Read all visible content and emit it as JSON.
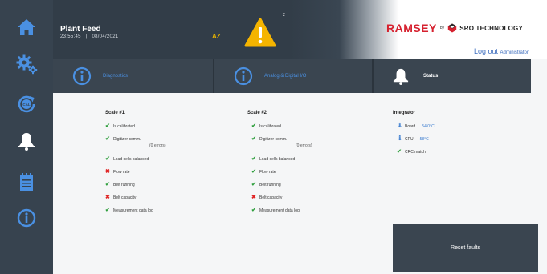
{
  "header": {
    "plant_name": "Plant Feed",
    "time": "23:55:45",
    "separator": "|",
    "date": "08/04/2021",
    "user_initials": "AZ",
    "alarm_count": "2",
    "logo_ramsey": "RAMSEY",
    "logo_by": "by",
    "logo_sro": "SRO TECHNOLOGY",
    "logout_label": "Log out",
    "logout_role": "Administrator"
  },
  "tabs": [
    {
      "label": "Diagnostics",
      "icon": "info-icon"
    },
    {
      "label": "Analog & Digital I/O",
      "icon": "info-icon"
    },
    {
      "label": "Status",
      "icon": "bell-icon"
    }
  ],
  "scale1": {
    "title": "Scale #1",
    "items": [
      {
        "label": "Is calibrated",
        "status": "ok"
      },
      {
        "label": "Digitizer comm.",
        "status": "ok",
        "sub": "(0 errors)"
      },
      {
        "label": "Load cells balanced",
        "status": "ok"
      },
      {
        "label": "Flow rate",
        "status": "bad"
      },
      {
        "label": "Belt running",
        "status": "ok"
      },
      {
        "label": "Belt capacity",
        "status": "bad"
      },
      {
        "label": "Measurement data log",
        "status": "ok"
      }
    ]
  },
  "scale2": {
    "title": "Scale #2",
    "items": [
      {
        "label": "Is calibrated",
        "status": "ok"
      },
      {
        "label": "Digitizer comm.",
        "status": "ok",
        "sub": "(0 errors)"
      },
      {
        "label": "Load cells balanced",
        "status": "ok"
      },
      {
        "label": "Flow rate",
        "status": "ok"
      },
      {
        "label": "Belt running",
        "status": "ok"
      },
      {
        "label": "Belt capacity",
        "status": "bad"
      },
      {
        "label": "Measurement data log",
        "status": "ok"
      }
    ]
  },
  "integrator": {
    "title": "Integrator",
    "board_label": "Board",
    "board_value": "54.0°C",
    "cpu_label": "CPU",
    "cpu_value": "58°C",
    "crc_label": "CRC match"
  },
  "reset_label": "Reset faults",
  "colors": {
    "sidebar": "#37434f",
    "accent_blue": "#4a90e2",
    "ok_green": "#2e9e3c",
    "fault_red": "#e02424",
    "warning_yellow": "#f5b400",
    "brand_red": "#d6212f"
  }
}
